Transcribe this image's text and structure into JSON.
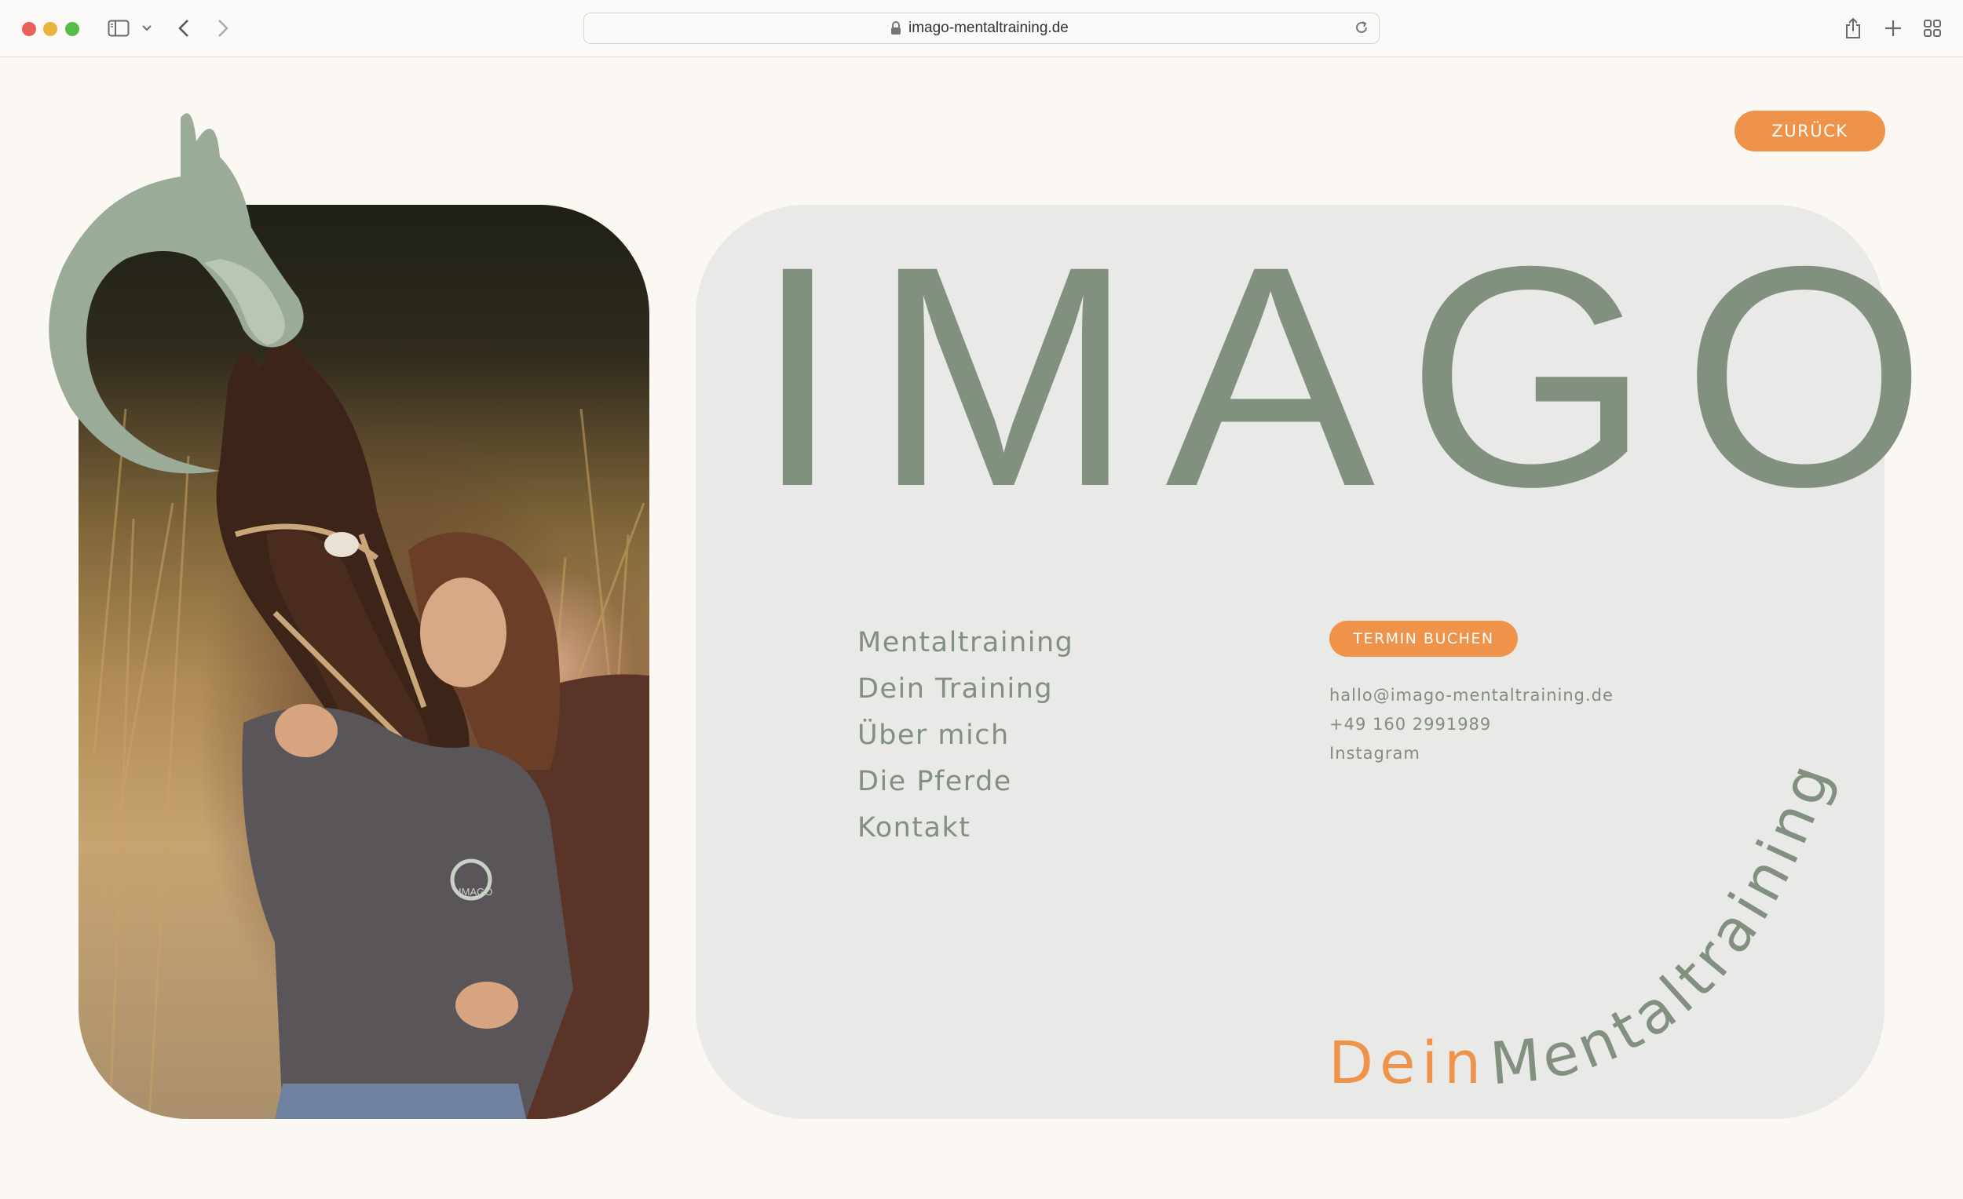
{
  "browser": {
    "url": "imago-mentaltraining.de"
  },
  "page": {
    "back_button": "ZURÜCK",
    "brand": "IMAGO",
    "nav": [
      {
        "label": "Mentaltraining"
      },
      {
        "label": "Dein Training"
      },
      {
        "label": "Über mich"
      },
      {
        "label": "Die Pferde"
      },
      {
        "label": "Kontakt"
      }
    ],
    "book_button": "TERMIN BUCHEN",
    "contact": {
      "email": "hallo@imago-mentaltraining.de",
      "phone": "+49 160 2991989",
      "social": "Instagram"
    },
    "tagline": {
      "first": "Dein",
      "second": "Mentaltraining"
    },
    "shirt_logo_text": "IMAGO"
  },
  "colors": {
    "background": "#fbf8f4",
    "card": "#e9e9e7",
    "sage": "#81907f",
    "accent": "#ef934b"
  }
}
